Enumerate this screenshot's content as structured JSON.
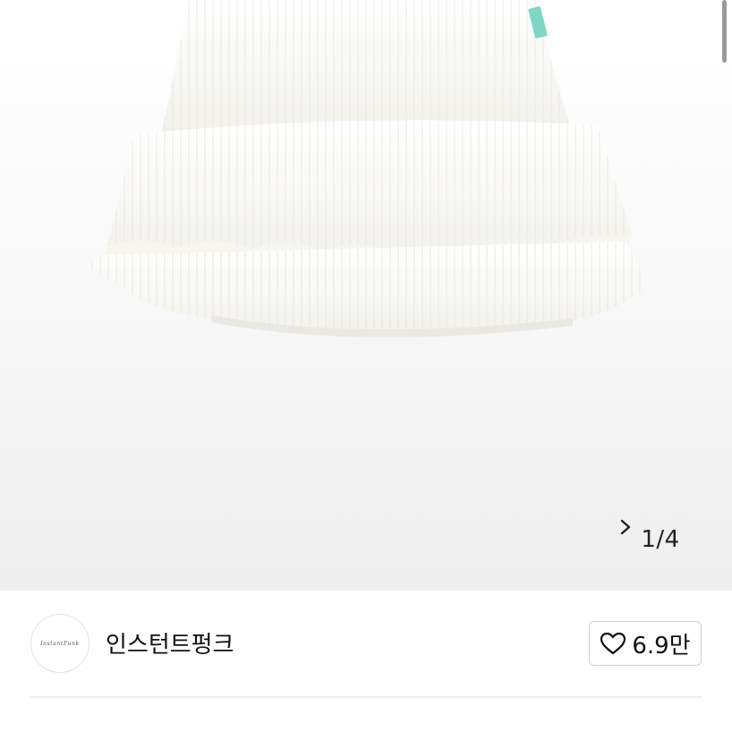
{
  "product_image": {
    "alt": "흰색 티어드 플리츠 미니 스커트",
    "counter": "1/4"
  },
  "shop": {
    "avatar_text": "InstantFunk",
    "name": "인스턴트펑크",
    "likes": "6.9만"
  },
  "icons": {
    "next": "chevron-right-icon",
    "like": "heart-icon"
  },
  "colors": {
    "accent_tag": "#7ed6c4"
  }
}
